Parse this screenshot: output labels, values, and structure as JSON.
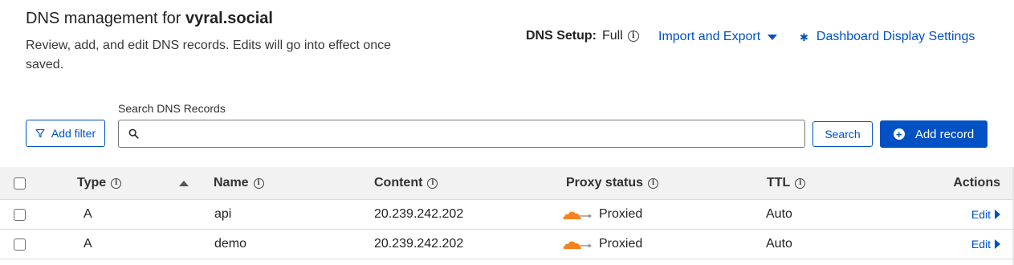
{
  "header": {
    "title_prefix": "DNS management for ",
    "domain": "vyral.social",
    "description": "Review, add, and edit DNS records. Edits will go into effect once saved."
  },
  "setup": {
    "label": "DNS Setup:",
    "value": "Full"
  },
  "links": {
    "import_export": "Import and Export",
    "display_settings": "Dashboard Display Settings"
  },
  "search": {
    "label": "Search DNS Records",
    "value": "",
    "placeholder": "",
    "button": "Search"
  },
  "filter": {
    "label": "Add filter"
  },
  "add_record": {
    "label": "Add record"
  },
  "table": {
    "headers": {
      "type": "Type",
      "name": "Name",
      "content": "Content",
      "proxy": "Proxy status",
      "ttl": "TTL",
      "actions": "Actions"
    },
    "rows": [
      {
        "type": "A",
        "name": "api",
        "content": "20.239.242.202",
        "proxy": "Proxied",
        "ttl": "Auto",
        "action": "Edit"
      },
      {
        "type": "A",
        "name": "demo",
        "content": "20.239.242.202",
        "proxy": "Proxied",
        "ttl": "Auto",
        "action": "Edit"
      }
    ]
  },
  "colors": {
    "accent": "#0051c3",
    "cloud": "#f6821f"
  },
  "icons": {
    "info": "info-icon",
    "caret": "chevron-down-icon",
    "gear": "gear-icon",
    "filter": "filter-icon",
    "search": "search-icon",
    "add": "plus-circle-icon",
    "cloud": "cloud-icon",
    "sort": "sort-ascending-icon",
    "edit_arrow": "chevron-right-icon"
  }
}
